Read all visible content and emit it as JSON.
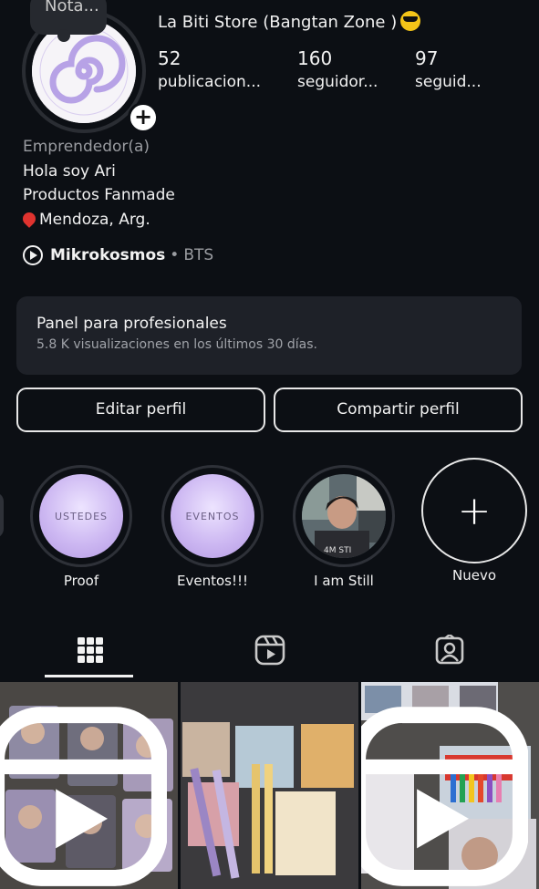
{
  "profile": {
    "note_label": "Nota...",
    "username": "La Biti Store (Bangtan Zone )",
    "emoji_icon": "sunglasses-face-emoji",
    "stats": {
      "posts_value": "52",
      "posts_label": "publicacion...",
      "followers_value": "160",
      "followers_label": "seguidor...",
      "following_value": "97",
      "following_label": "seguid..."
    }
  },
  "bio": {
    "category": "Emprendedor(a)",
    "line1": "Hola soy Ari",
    "line2": "Productos Fanmade",
    "location": "Mendoza, Arg."
  },
  "music": {
    "title": "Mikrokosmos",
    "separator": "•",
    "artist": "BTS"
  },
  "pro_panel": {
    "title": "Panel para profesionales",
    "subtitle": "5.8 K visualizaciones en los últimos 30 días."
  },
  "buttons": {
    "edit": "Editar perfil",
    "share": "Compartir perfil"
  },
  "highlights": [
    {
      "cover_text": "USTEDES",
      "label": "Proof"
    },
    {
      "cover_text": "EVENTOS",
      "label": "Eventos!!!"
    },
    {
      "cover_text": "",
      "label": "I am Still"
    },
    {
      "cover_text": "+",
      "label": "Nuevo"
    }
  ],
  "tabs": [
    {
      "icon": "grid-icon",
      "active": true
    },
    {
      "icon": "reels-icon",
      "active": false
    },
    {
      "icon": "tagged-icon",
      "active": false
    }
  ],
  "colors": {
    "background": "#0c0f14",
    "panel": "#1e2128",
    "highlight_lilac": "#cdb8f2"
  }
}
